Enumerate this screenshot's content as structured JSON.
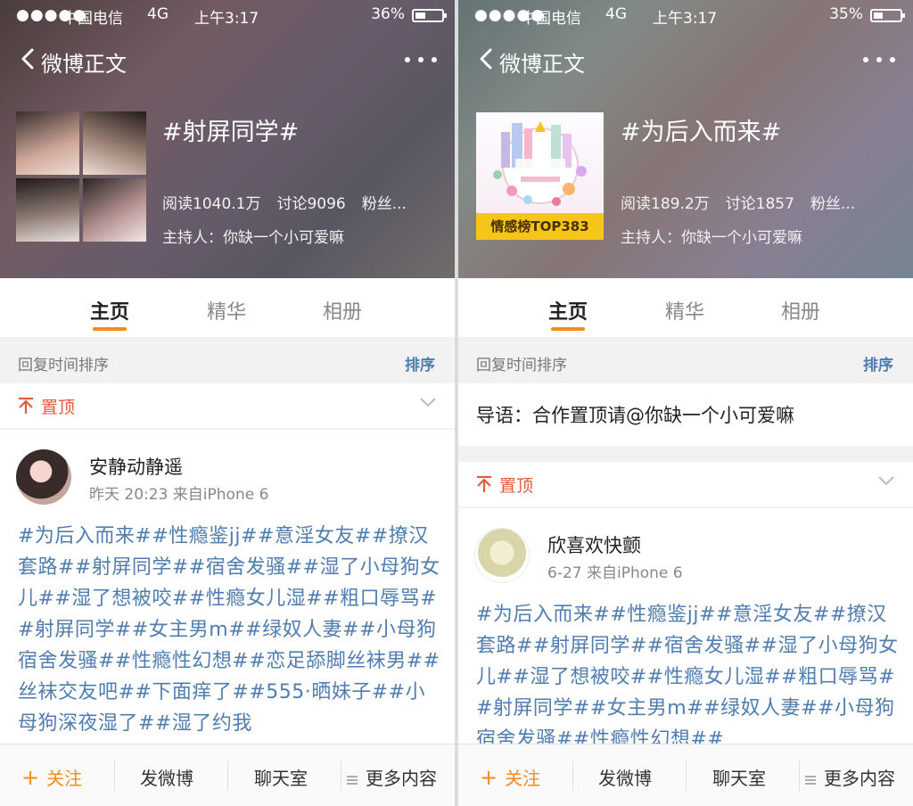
{
  "left": {
    "status": {
      "signal": "●●●●●",
      "carrier": "中国电信",
      "network": "4G",
      "time": "上午3:17",
      "battery": "36%"
    },
    "nav": {
      "title": "微博正文"
    },
    "topic": {
      "title": "#射屏同学#",
      "reads": "阅读1040.1万",
      "discussions": "讨论9096",
      "fans": "粉丝...",
      "host": "主持人：你缺一个小可爱嘛"
    },
    "tabs": [
      "主页",
      "精华",
      "相册"
    ],
    "sort": {
      "label": "回复时间排序",
      "button": "排序"
    },
    "pinned": {
      "label": "置顶"
    },
    "post": {
      "author": "安静动静遥",
      "meta": "昨天 20:23  来自iPhone 6",
      "text": "#为后入而来##性瘾鉴jj##意淫女友##撩汉套路##射屏同学##宿舍发骚##湿了小母狗女儿##湿了想被咬##性瘾女儿湿##粗口辱骂##射屏同学##女主男m##绿奴人妻##小母狗宿舍发骚##性瘾性幻想##恋足舔脚丝袜男##丝袜交友吧##下面痒了##555·晒妹子##小母狗深夜湿了##湿了约我"
    },
    "bottom": {
      "follow": "关注",
      "post": "发微博",
      "chat": "聊天室",
      "more": "更多内容"
    }
  },
  "right": {
    "status": {
      "signal": "●●●●●",
      "carrier": "中国电信",
      "network": "4G",
      "time": "上午3:17",
      "battery": "35%"
    },
    "nav": {
      "title": "微博正文"
    },
    "topic": {
      "title": "#为后入而来#",
      "badge": "情感榜TOP383",
      "reads": "阅读189.2万",
      "discussions": "讨论1857",
      "fans": "粉丝...",
      "host": "主持人：你缺一个小可爱嘛"
    },
    "tabs": [
      "主页",
      "精华",
      "相册"
    ],
    "sort": {
      "label": "回复时间排序",
      "button": "排序"
    },
    "guide": "导语：合作置顶请@你缺一个小可爱嘛",
    "pinned": {
      "label": "置顶"
    },
    "post": {
      "author": "欣喜欢快颤",
      "meta": "6-27  来自iPhone 6",
      "text": "#为后入而来##性瘾鉴jj##意淫女友##撩汉套路##射屏同学##宿舍发骚##湿了小母狗女儿##湿了想被咬##性瘾女儿湿##粗口辱骂##射屏同学##女主男m##绿奴人妻##小母狗宿舍发骚##性瘾性幻想##"
    },
    "bottom": {
      "follow": "关注",
      "post": "发微博",
      "chat": "聊天室",
      "more": "更多内容"
    }
  },
  "colors": {
    "accent": "#f48b1f",
    "link": "#507daf",
    "pin": "#e45a3c",
    "rank_band": "#f5c518"
  }
}
